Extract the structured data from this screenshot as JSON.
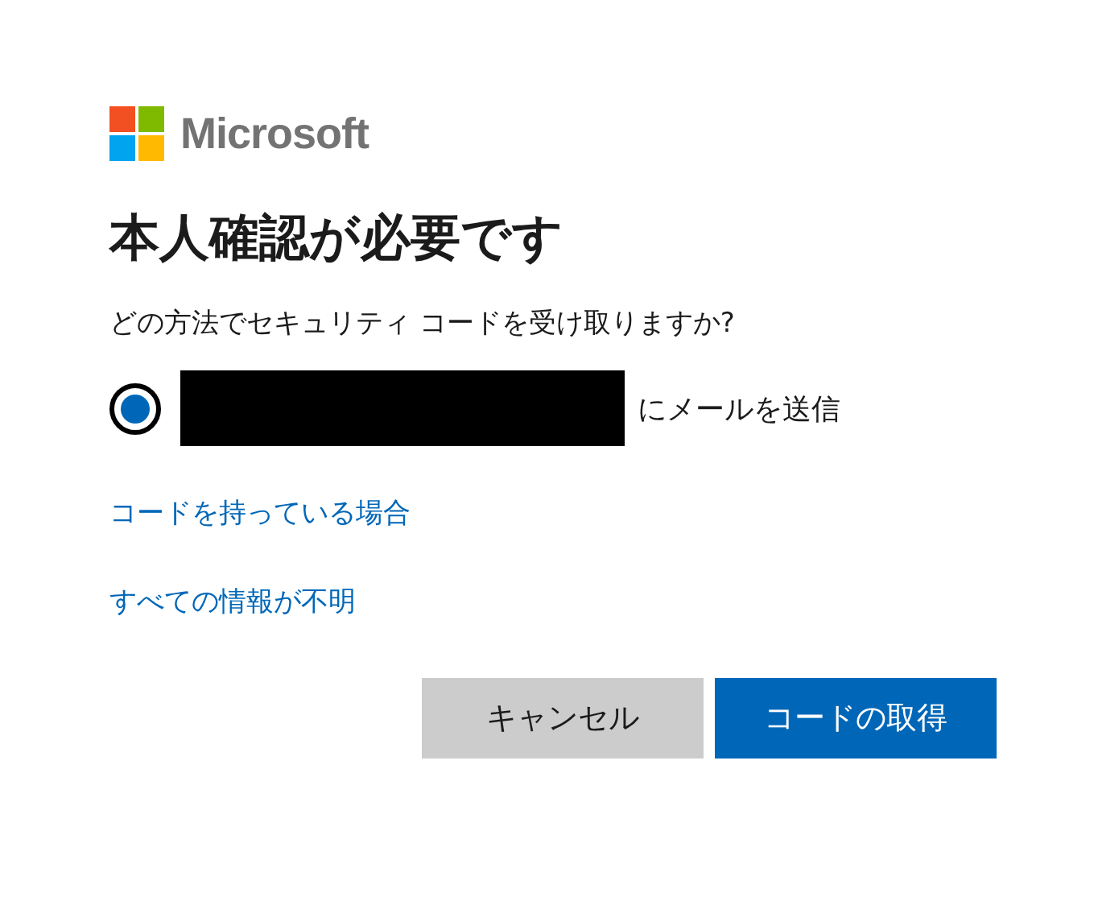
{
  "logo": {
    "wordmark": "Microsoft"
  },
  "title": "本人確認が必要です",
  "prompt": "どの方法でセキュリティ コードを受け取りますか?",
  "options": [
    {
      "label": "にメールを送信",
      "selected": true,
      "redacted": true
    }
  ],
  "links": [
    "コードを持っている場合",
    "すべての情報が不明"
  ],
  "buttons": [
    {
      "label": "キャンセル",
      "kind": "secondary"
    },
    {
      "label": "コードの取得",
      "kind": "primary"
    }
  ]
}
